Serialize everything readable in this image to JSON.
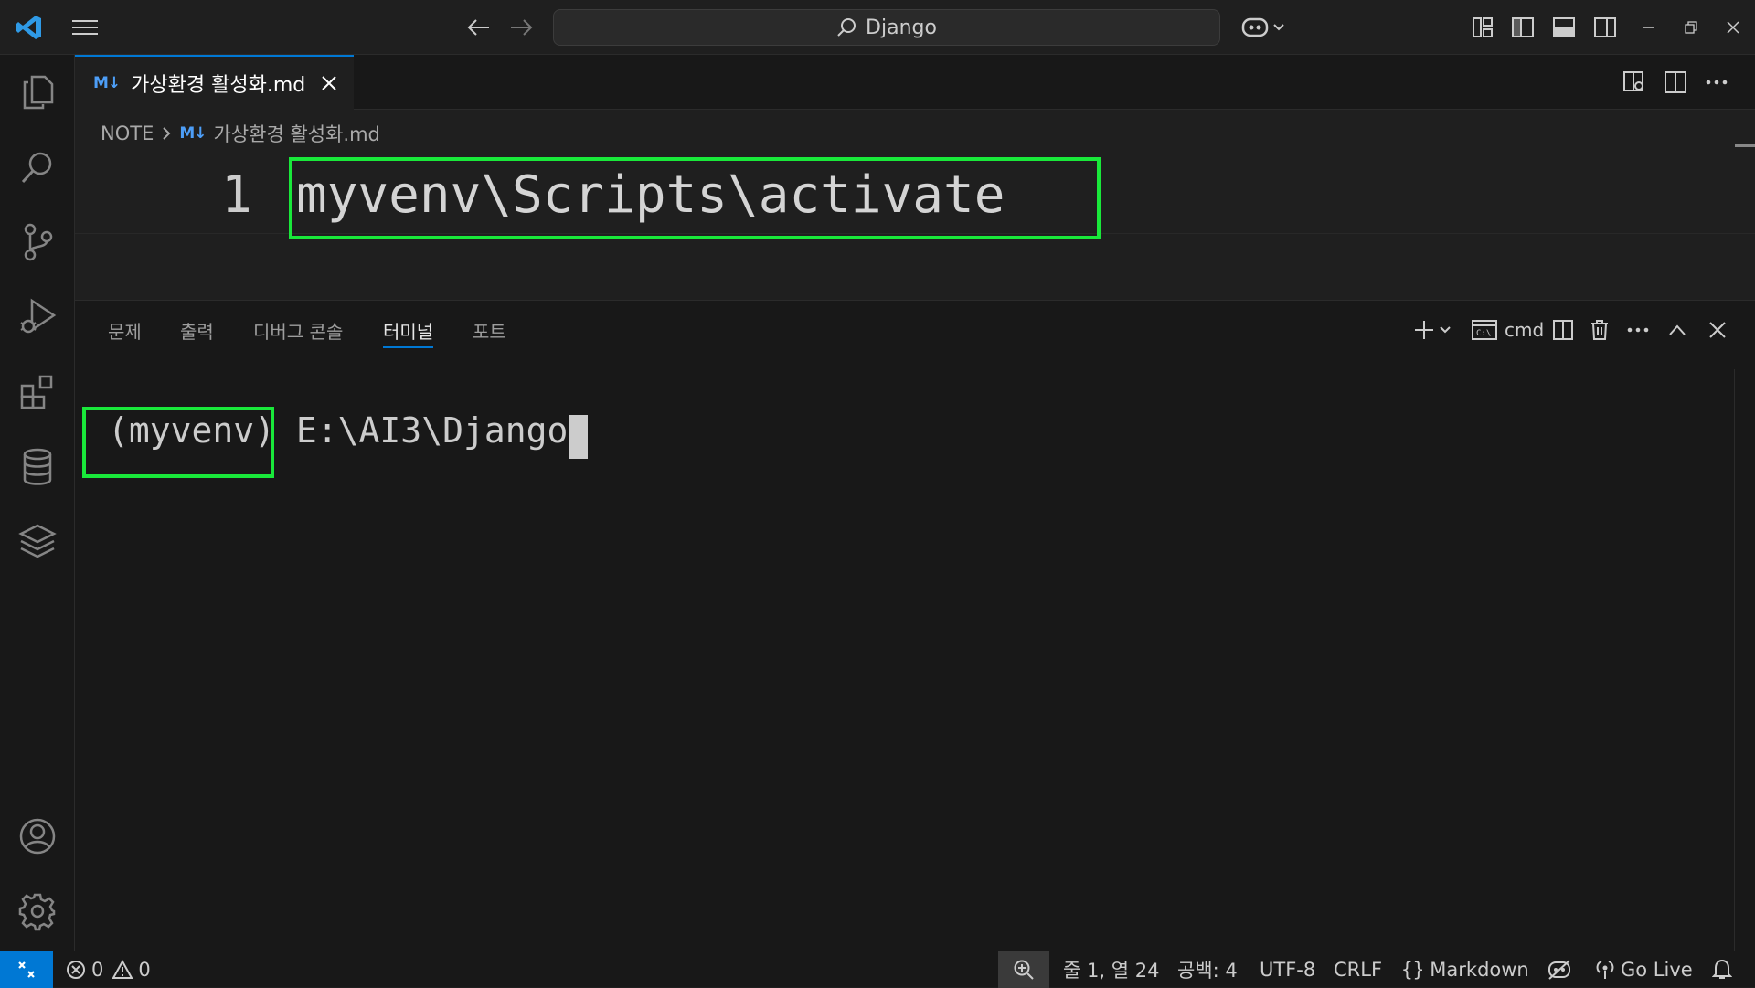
{
  "titlebar": {
    "search_text": "Django"
  },
  "editor": {
    "tab_label": "가상환경 활성화.md",
    "tab_icon_text": "M↓",
    "breadcrumb": {
      "folder": "NOTE",
      "file": "가상환경 활성화.md"
    },
    "line_number": "1",
    "line_text": "myvenv\\Scripts\\activate"
  },
  "panel": {
    "tabs": [
      "문제",
      "출력",
      "디버그 콘솔",
      "터미널",
      "포트"
    ],
    "active_tab": "터미널",
    "terminal_profile": "cmd",
    "prompt_env": "(myvenv)",
    "prompt_path": "E:\\AI3\\Django>"
  },
  "statusbar": {
    "errors": "0",
    "warnings": "0",
    "position": "줄 1, 열 24",
    "spaces": "공백: 4",
    "encoding": "UTF-8",
    "eol": "CRLF",
    "language": "Markdown",
    "go_live": "Go Live"
  },
  "colors": {
    "accent": "#0078d4",
    "highlight_box": "#19e83a",
    "remote_button": "#0078d4",
    "editor_bg": "#1f1f1f",
    "panel_bg": "#181818"
  }
}
